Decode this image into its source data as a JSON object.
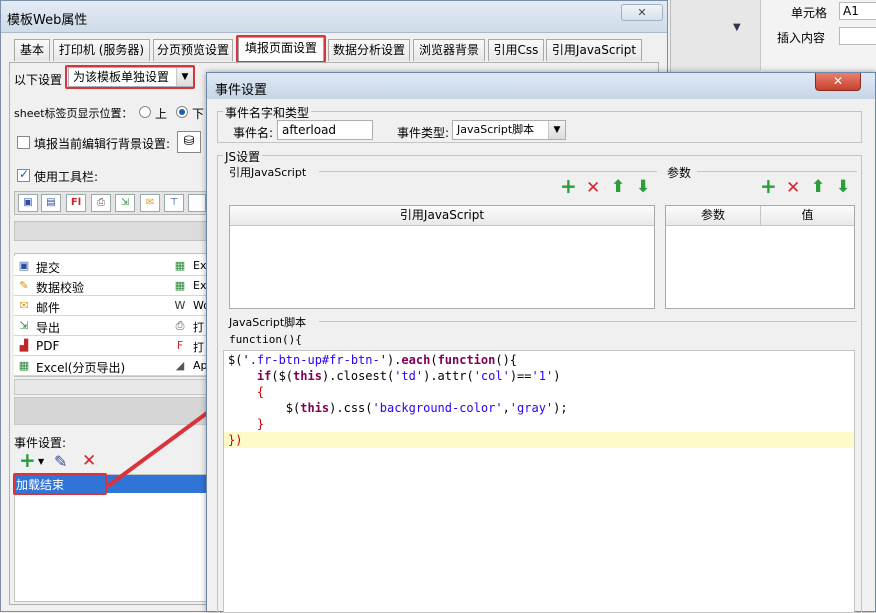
{
  "right_panel": {
    "cell_label": "单元格",
    "cell_value": "A1",
    "insert_label": "插入内容"
  },
  "main_window": {
    "title": "模板Web属性",
    "tabs": [
      "基本",
      "打印机 (服务器)",
      "分页预览设置",
      "填报页面设置",
      "数据分析设置",
      "浏览器背景",
      "引用Css",
      "引用JavaScript"
    ],
    "following_label": "以下设置",
    "setting_mode": "为该模板单独设置",
    "sheet_label": "sheet标签页显示位置：",
    "radio_up": "上",
    "radio_down": "下",
    "bg_label": "填报当前编辑行背景设置:",
    "use_toolbar": "使用工具栏:",
    "toolbar_items": [
      {
        "icon": "save-icon",
        "label": "提交"
      },
      {
        "icon": "verify-icon",
        "label": "数据校验"
      },
      {
        "icon": "mail-icon",
        "label": "邮件"
      },
      {
        "icon": "export-icon",
        "label": "导出"
      },
      {
        "icon": "pdf-icon",
        "label": "PDF"
      },
      {
        "icon": "excel-icon",
        "label": "Excel(分页导出)"
      }
    ],
    "toolbar_items_col2": [
      {
        "icon": "excel-icon",
        "label": "Exc"
      },
      {
        "icon": "excel-icon",
        "label": "Exc"
      },
      {
        "icon": "word-icon",
        "label": "Wor"
      },
      {
        "icon": "print-icon",
        "label": "打印"
      },
      {
        "icon": "flash-icon",
        "label": "打印"
      },
      {
        "icon": "applet-icon",
        "label": "App"
      }
    ],
    "event_settings_label": "事件设置:",
    "event_item": "加载结束"
  },
  "dialog": {
    "title": "事件设置",
    "close_symbol": "✕",
    "group_name_type": "事件名字和类型",
    "event_name_label": "事件名:",
    "event_name_value": "afterload",
    "event_type_label": "事件类型:",
    "event_type_value": "JavaScript脚本",
    "js_group": "JS设置",
    "ref_js_label": "引用JavaScript",
    "params_label": "参数",
    "ref_table_header": "引用JavaScript",
    "param_header": "参数",
    "value_header": "值",
    "script_label": "JavaScript脚本",
    "func_prefix": "function(){",
    "code_lines": [
      {
        "parts": [
          [
            "pl",
            "$('"
          ],
          [
            "str",
            ".fr-btn-up#fr-btn-"
          ],
          [
            "pl",
            "')."
          ],
          [
            "kw",
            "each"
          ],
          [
            "pl",
            "("
          ],
          [
            "kw",
            "function"
          ],
          [
            "pl",
            "(){"
          ]
        ],
        "highlight": false
      },
      {
        "parts": [
          [
            "pl",
            "    "
          ],
          [
            "kw",
            "if"
          ],
          [
            "pl",
            "($("
          ],
          [
            "kw",
            "this"
          ],
          [
            "pl",
            ").closest("
          ],
          [
            "str",
            "'td'"
          ],
          [
            "pl",
            ").attr("
          ],
          [
            "str",
            "'col'"
          ],
          [
            "pl",
            ")=="
          ],
          [
            "str",
            "'1'"
          ],
          [
            "pl",
            ")"
          ]
        ],
        "highlight": false
      },
      {
        "parts": [
          [
            "pl",
            "    "
          ],
          [
            "brace",
            "{"
          ]
        ],
        "highlight": false
      },
      {
        "parts": [
          [
            "pl",
            "        $("
          ],
          [
            "kw",
            "this"
          ],
          [
            "pl",
            ").css("
          ],
          [
            "str",
            "'background-color'"
          ],
          [
            "pl",
            ","
          ],
          [
            "str",
            "'gray'"
          ],
          [
            "pl",
            ");"
          ]
        ],
        "highlight": false
      },
      {
        "parts": [
          [
            "pl",
            "    "
          ],
          [
            "brace",
            "}"
          ]
        ],
        "highlight": false
      },
      {
        "parts": [
          [
            "brace",
            "})"
          ]
        ],
        "highlight": true
      }
    ]
  },
  "colors": {
    "accent_red": "#d9343a",
    "selection_blue": "#3074d8",
    "highlight_yellow": "#fffbc8"
  }
}
